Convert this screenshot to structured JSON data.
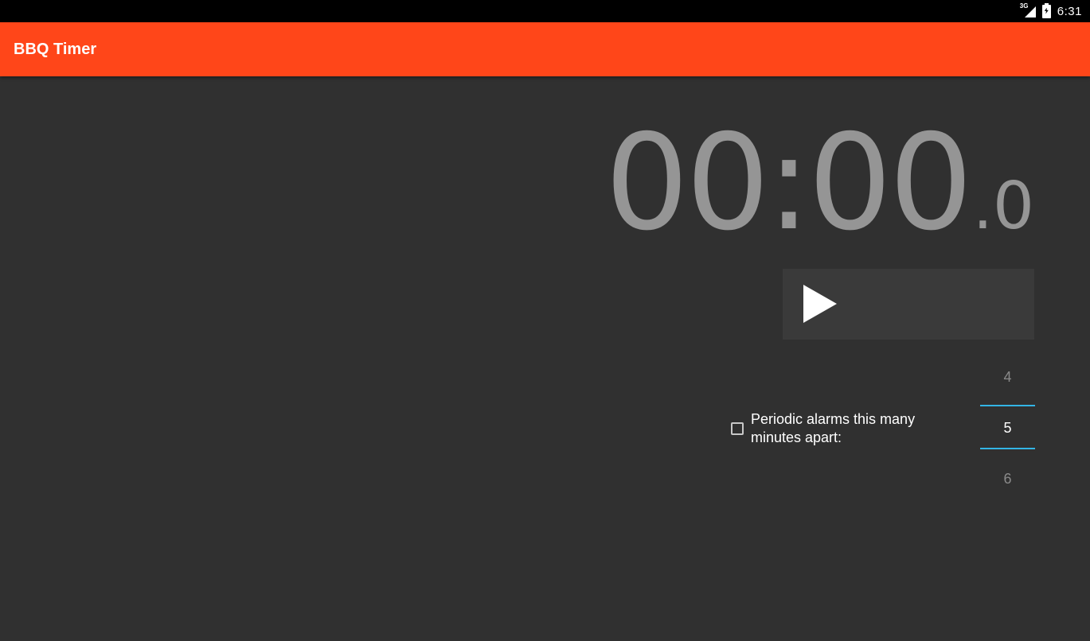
{
  "status_bar": {
    "network_type": "3G",
    "time": "6:31",
    "icons": [
      "signal-icon",
      "battery-charging-icon"
    ]
  },
  "app_bar": {
    "title": "BBQ Timer",
    "color": "#ff4619"
  },
  "timer": {
    "main": "00:00",
    "separator": ".",
    "tenths": "0"
  },
  "controls": {
    "play_icon": "play-icon"
  },
  "periodic": {
    "checked": false,
    "label": "Periodic alarms this many minutes apart:"
  },
  "number_picker": {
    "previous": "4",
    "current": "5",
    "next": "6",
    "accent_color": "#33b5e5"
  }
}
